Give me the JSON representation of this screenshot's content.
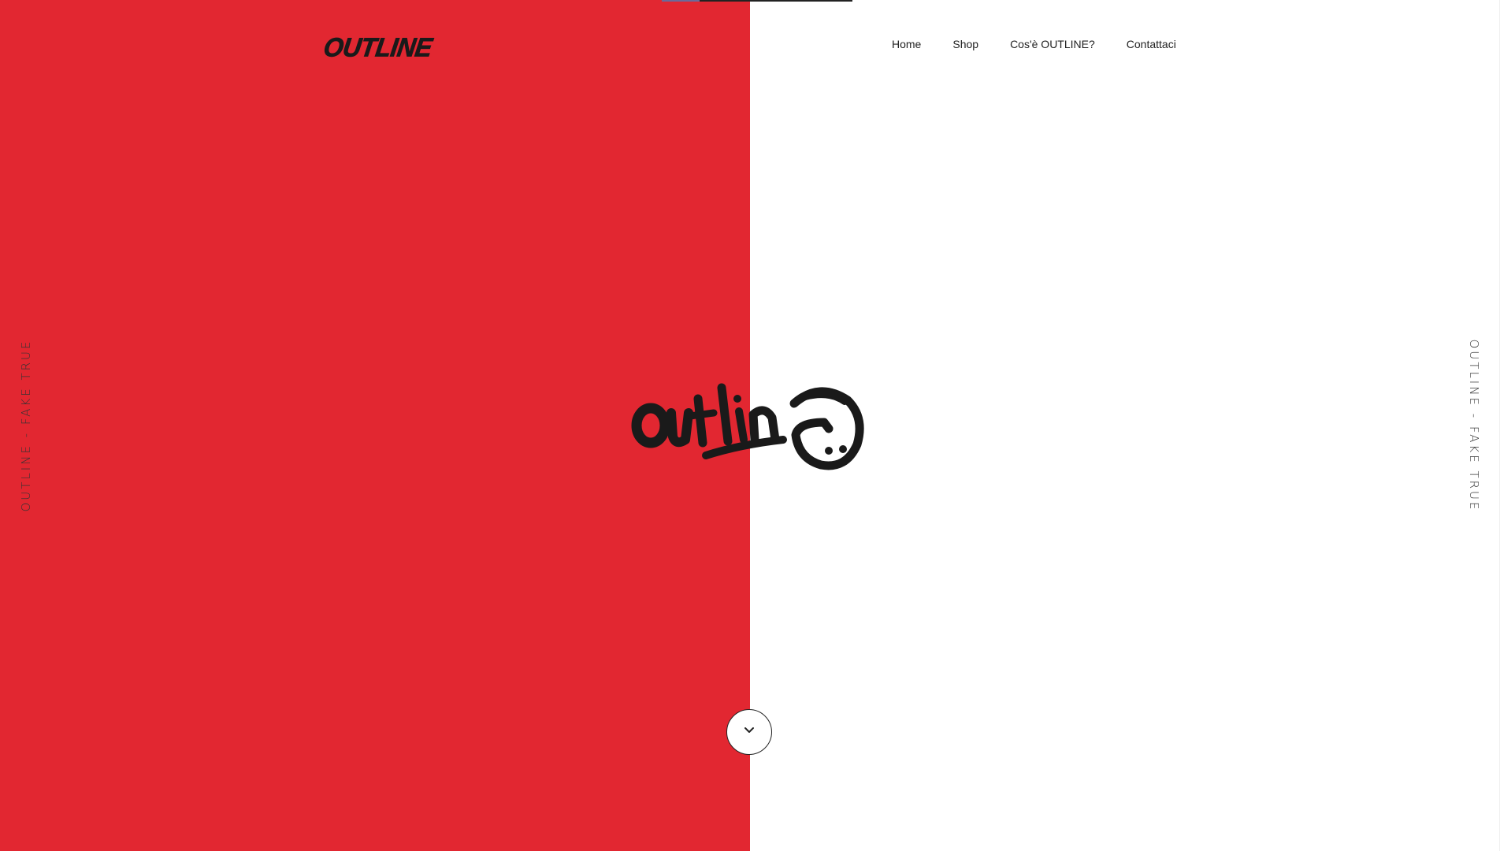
{
  "colors": {
    "accent_red": "#e22731",
    "ink": "#1a1a1a",
    "background": "#ffffff"
  },
  "header": {
    "logo_text": "OUTLINE",
    "nav": [
      {
        "label": "Home"
      },
      {
        "label": "Shop"
      },
      {
        "label": "Cos'è OUTLINE?"
      },
      {
        "label": "Contattaci"
      }
    ]
  },
  "side_text": {
    "left": "OUTLINE - FAKE TRUE",
    "right": "OUTLINE - FAKE TRUE"
  },
  "hero": {
    "logo_text": "outline",
    "logo_style": "graffiti tag"
  },
  "scroll_button": {
    "icon": "chevron-down-icon"
  }
}
